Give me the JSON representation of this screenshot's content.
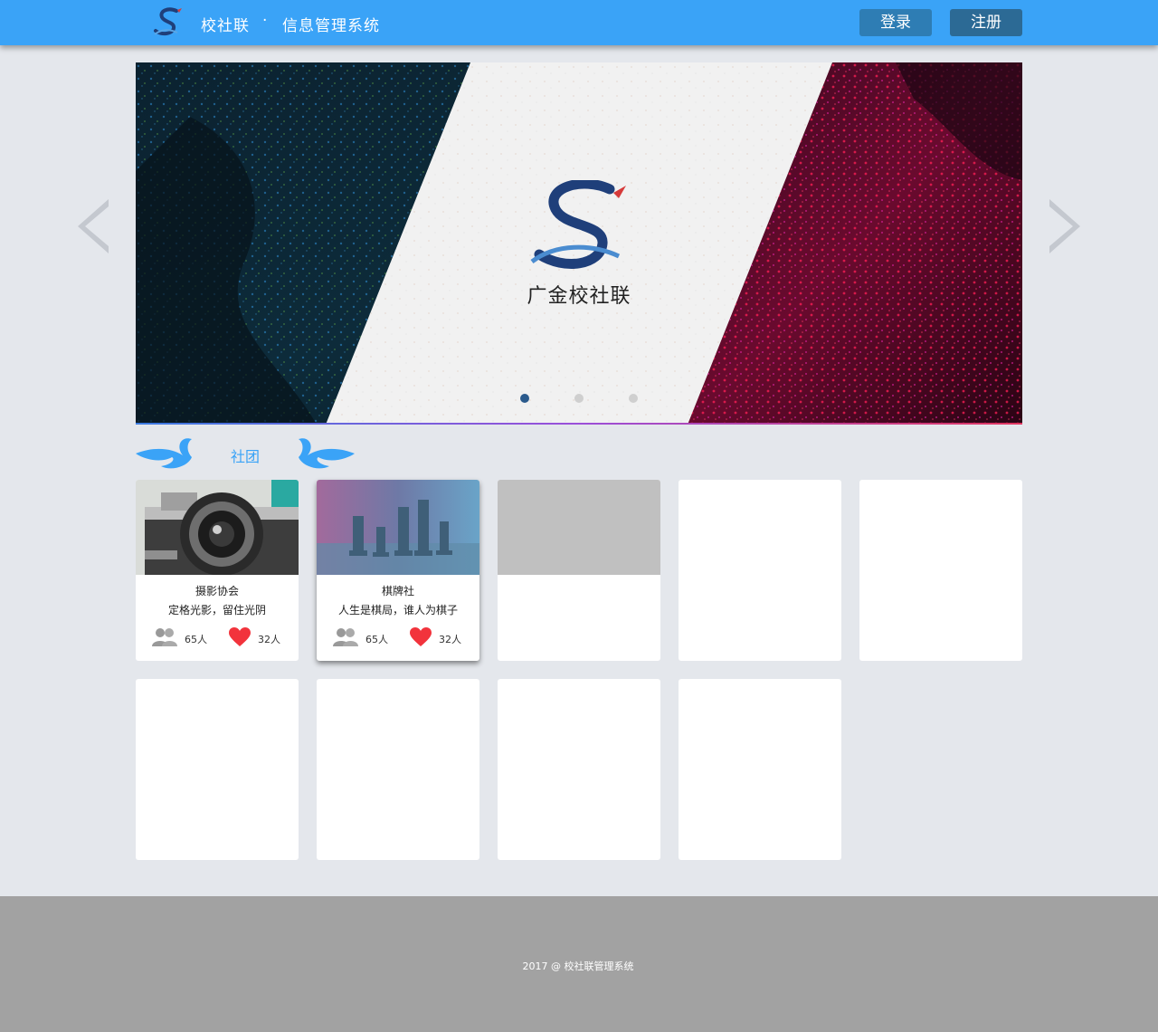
{
  "header": {
    "brand": "校社联",
    "separator": "·",
    "subtitle": "信息管理系统",
    "login_label": "登录",
    "register_label": "注册"
  },
  "banner": {
    "title": "广金校社联",
    "slides_total": 3,
    "active_slide": 1
  },
  "section": {
    "title": "社团"
  },
  "clubs": [
    {
      "name": "摄影协会",
      "motto": "定格光影，留住光阴",
      "members": "65人",
      "likes": "32人"
    },
    {
      "name": "棋牌社",
      "motto": "人生是棋局，谁人为棋子",
      "members": "65人",
      "likes": "32人"
    }
  ],
  "footer": {
    "text": "2017 @ 校社联管理系统"
  },
  "colors": {
    "header": "#3aa3f7",
    "login_button": "#2e7db4",
    "register_button": "#2c6a95",
    "page_background": "#e4e7ec",
    "footer": "#a2a2a2",
    "heart": "#f2333c"
  }
}
